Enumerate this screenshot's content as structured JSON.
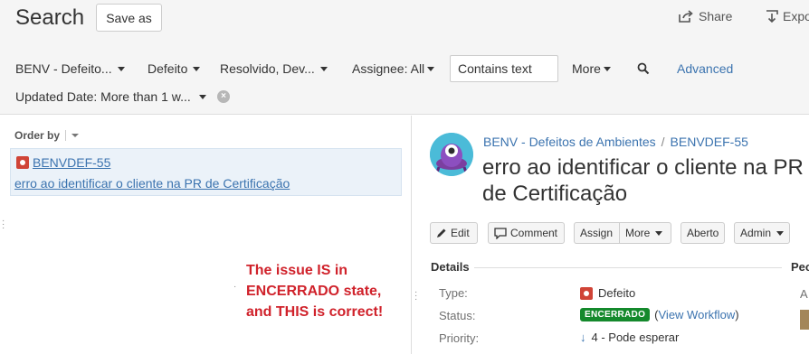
{
  "header": {
    "title": "Search",
    "save_as": "Save as",
    "share": "Share",
    "export": "Expo"
  },
  "filters": {
    "project": "BENV - Defeito...",
    "type": "Defeito",
    "status": "Resolvido, Dev...",
    "assignee": "Assignee: All",
    "contains_placeholder": "Contains text",
    "more": "More",
    "advanced": "Advanced",
    "updated": "Updated Date: More than 1 w..."
  },
  "list": {
    "order_by": "Order by",
    "items": [
      {
        "key": "BENVDEF-55",
        "summary": "erro ao identificar o cliente na PR de Certificação"
      }
    ]
  },
  "annotation": {
    "lines": [
      "The issue IS in",
      "ENCERRADO state,",
      "and THIS is correct!"
    ],
    "color": "#d0222b"
  },
  "issue": {
    "project": "BENV - Defeitos de Ambientes",
    "separator": "/",
    "key": "BENVDEF-55",
    "title_line1": "erro ao identificar o cliente na PR",
    "title_line2": "de Certificação",
    "buttons": {
      "edit": "Edit",
      "comment": "Comment",
      "assign": "Assign",
      "more": "More",
      "status": "Aberto",
      "admin": "Admin"
    },
    "details_heading": "Details",
    "people_heading": "Peo",
    "people_first": "A",
    "fields": {
      "type_label": "Type:",
      "type_value": "Defeito",
      "status_label": "Status:",
      "status_value": "ENCERRADO",
      "workflow_open": "(",
      "workflow_link": "View Workflow",
      "workflow_close": ")",
      "priority_label": "Priority:",
      "priority_arrow": "↓",
      "priority_value": "4 - Pode esperar"
    }
  },
  "colors": {
    "link": "#3b73af",
    "status_green": "#14892c",
    "bug_red": "#d04437",
    "avatar": "#4bbbd8"
  }
}
